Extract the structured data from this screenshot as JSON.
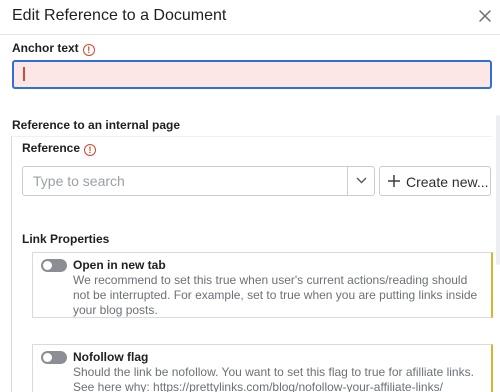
{
  "dialog": {
    "title": "Edit Reference to a Document",
    "close_icon": "close-icon"
  },
  "anchor": {
    "label": "Anchor text",
    "warning_icon": "warning-icon",
    "warning_glyph": "!",
    "value": ""
  },
  "internal": {
    "label": "Reference to an internal page",
    "reference_label": "Reference",
    "placeholder": "Type to search",
    "dropdown_icon": "chevron-down-icon",
    "create_icon": "plus-icon",
    "create_label": "Create new..."
  },
  "link_properties": {
    "label": "Link Properties",
    "items": [
      {
        "title": "Open in new tab",
        "description": "We recommend to set this true when user's current actions/reading should not be interrupted. For example, set to true when you are putting links inside your blog posts.",
        "enabled": false
      },
      {
        "title": "Nofollow flag",
        "description": "Should the link be nofollow. You want to set this flag to true for afilliate links. See here why: https://prettylinks.com/blog/nofollow-your-affiliate-links/",
        "enabled": false
      }
    ]
  },
  "colors": {
    "input_error_bg": "#fce6e6",
    "focus_border": "#2f6fd8",
    "warning": "#d2452f",
    "card_accent": "#d6b531"
  }
}
